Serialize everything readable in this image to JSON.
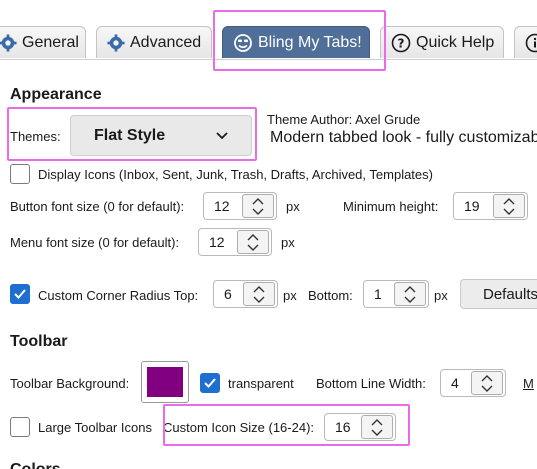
{
  "tabs": [
    {
      "label": "General",
      "icon": "gear-icon"
    },
    {
      "label": "Advanced",
      "icon": "gear-icon"
    },
    {
      "label": "Bling My Tabs!",
      "icon": "smiley-icon",
      "active": true
    },
    {
      "label": "Quick Help",
      "icon": "question-icon"
    },
    {
      "label": "",
      "icon": "info-icon"
    }
  ],
  "appearance": {
    "title": "Appearance",
    "themes_label": "Themes:",
    "theme_value": "Flat Style",
    "theme_author": "Theme Author: Axel Grude",
    "theme_description": "Modern tabbed look - fully customizable",
    "display_icons_label": "Display Icons (Inbox, Sent, Junk, Trash, Drafts, Archived, Templates)",
    "display_icons_checked": false,
    "button_font_label": "Button font size (0 for default):",
    "button_font_value": "12",
    "button_font_unit": "px",
    "min_height_label": "Minimum height:",
    "min_height_value": "19",
    "menu_font_label": "Menu font size (0 for default):",
    "menu_font_value": "12",
    "menu_font_unit": "px",
    "corner_checked": true,
    "corner_label": "Custom Corner Radius Top:",
    "corner_top_value": "6",
    "corner_top_unit": "px",
    "corner_bottom_label": "Bottom:",
    "corner_bottom_value": "1",
    "corner_bottom_unit": "px",
    "defaults_button": "Defaults"
  },
  "toolbar": {
    "title": "Toolbar",
    "background_label": "Toolbar Background:",
    "background_color": "#800080",
    "transparent_checked": true,
    "transparent_label": "transparent",
    "bottom_line_label": "Bottom Line Width:",
    "bottom_line_value": "4",
    "bottom_line_more": "M",
    "large_icons_checked": false,
    "large_icons_label": "Large Toolbar Icons",
    "custom_icon_label": "Custom Icon Size (16-24):",
    "custom_icon_value": "16"
  },
  "next_section_partial": "Colors",
  "colors": {
    "accent": "#1e6fd0",
    "active_tab": "#4f6f99",
    "highlight": "#e86ce8"
  }
}
